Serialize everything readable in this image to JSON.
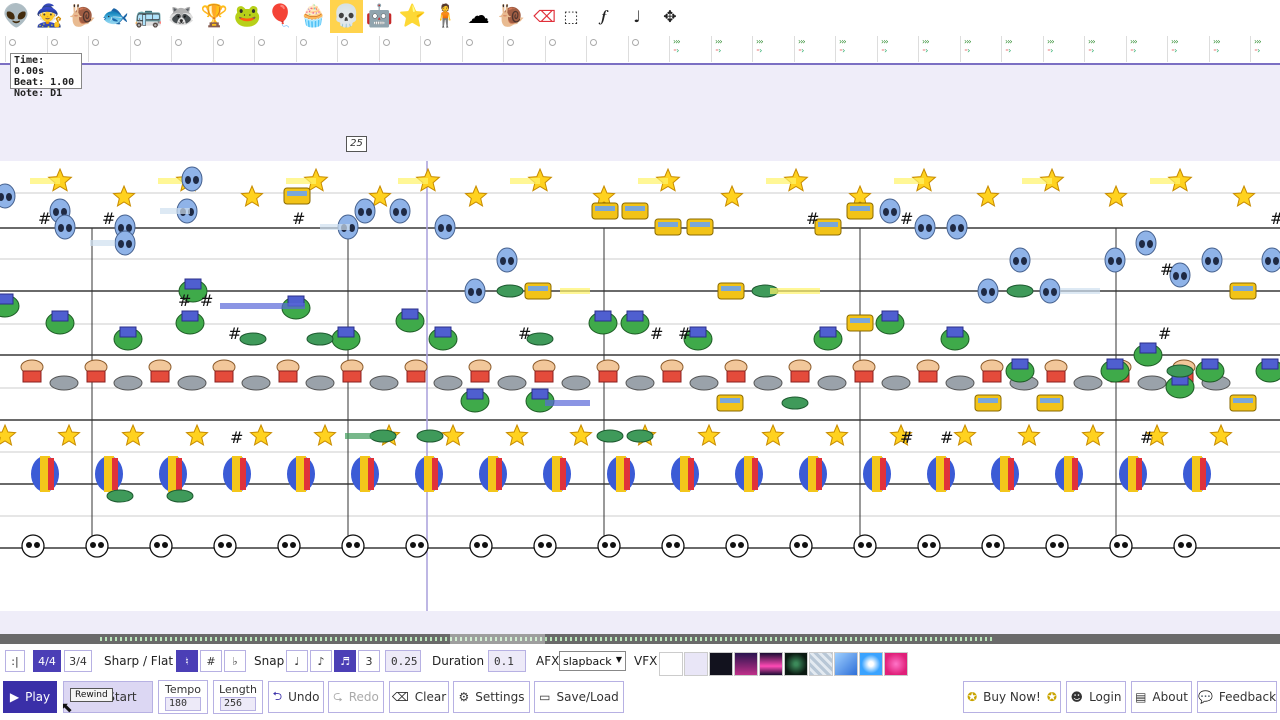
{
  "palette": {
    "instruments": [
      {
        "name": "alien-icon",
        "glyph": "👽"
      },
      {
        "name": "gnome-icon",
        "glyph": "🧙"
      },
      {
        "name": "snail-icon",
        "glyph": "🐌"
      },
      {
        "name": "fish-icon",
        "glyph": "🐟"
      },
      {
        "name": "school-bus-icon",
        "glyph": "🚌"
      },
      {
        "name": "raccoon-icon",
        "glyph": "🦝"
      },
      {
        "name": "trophy-icon",
        "glyph": "🏆"
      },
      {
        "name": "frog-icon",
        "glyph": "🐸"
      },
      {
        "name": "balloon-icon",
        "glyph": "🎈"
      },
      {
        "name": "muffin-icon",
        "glyph": "🧁"
      },
      {
        "name": "skull-icon",
        "glyph": "💀"
      },
      {
        "name": "robot-icon",
        "glyph": "🤖"
      },
      {
        "name": "star-icon",
        "glyph": "⭐"
      },
      {
        "name": "doll-icon",
        "glyph": "🧍"
      },
      {
        "name": "cloud-icon",
        "glyph": "☁"
      },
      {
        "name": "snail-orange-icon",
        "glyph": "🐌"
      },
      {
        "name": "eraser-icon",
        "glyph": "⌫"
      }
    ],
    "selected_index": 10,
    "tools": [
      {
        "name": "select-box-icon",
        "glyph": "⬚"
      },
      {
        "name": "forte-icon",
        "glyph": "𝆑"
      },
      {
        "name": "note-icon",
        "glyph": "♩"
      },
      {
        "name": "move-icon",
        "glyph": "✥"
      }
    ]
  },
  "readout": {
    "time": "Time: 0.00s",
    "beat": "Beat: 1.00",
    "note": "Note: D1"
  },
  "measure_number": "25",
  "toolbar": {
    "time_sig_44": "4/4",
    "time_sig_34": "3/4",
    "sharp_flat_label": "Sharp / Flat",
    "natural": "♮",
    "sharp": "#",
    "flat": "♭",
    "snap_label": "Snap",
    "snap_quarter": "♩",
    "snap_eighth": "♪",
    "snap_sixteenth": "♬",
    "snap_triplet": "3",
    "snap_value": "0.25",
    "duration_label": "Duration",
    "duration_value": "0.1",
    "afx_label": "AFX",
    "afx_value": "slapback",
    "vfx_label": "VFX"
  },
  "controls": {
    "play": "Play",
    "to_start": "o Start",
    "rewind_tooltip": "Rewind",
    "tempo_label": "Tempo",
    "tempo_value": "180",
    "length_label": "Length",
    "length_value": "256",
    "undo": "Undo",
    "redo": "Redo",
    "clear": "Clear",
    "settings": "Settings",
    "save_load": "Save/Load",
    "buy_now": "Buy Now!",
    "login": "Login",
    "about": "About",
    "feedback": "Feedback"
  },
  "colors": {
    "accent": "#3a2fa8",
    "staff_bg": "#efedf9",
    "star": "#ffd21f",
    "alien": "#8fb3e8",
    "frog": "#3faa4a",
    "bus": "#f2c318",
    "muffin": "#e44b3b",
    "balloon": "#3b5bd6"
  }
}
